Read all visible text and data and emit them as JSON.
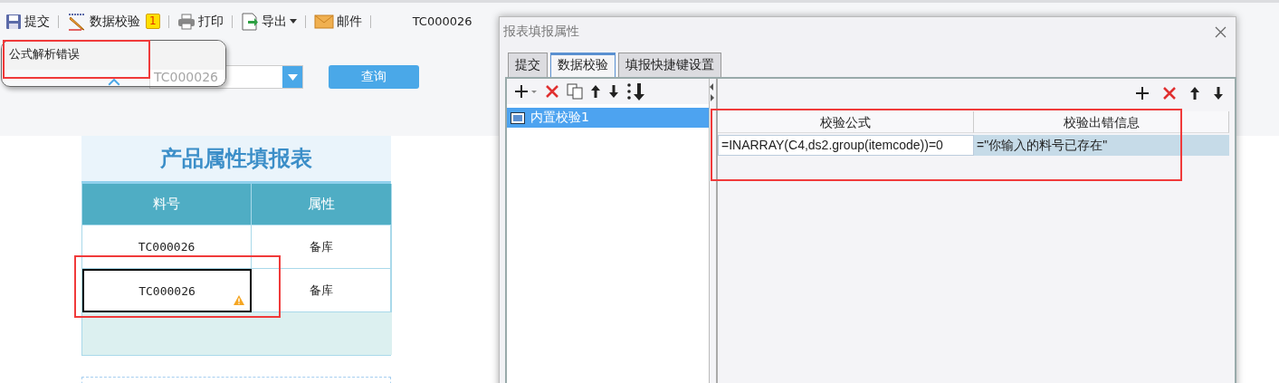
{
  "toolbar": {
    "items": [
      {
        "label": "提交"
      },
      {
        "label": "数据校验",
        "badge": "1"
      },
      {
        "label": "打印"
      },
      {
        "label": "导出",
        "dropdown": true
      },
      {
        "label": "邮件"
      }
    ],
    "value": "TC000026"
  },
  "query": {
    "combo_value": "TC000026",
    "button": "查询"
  },
  "tooltip": {
    "text": "公式解析错误"
  },
  "report": {
    "title": "产品属性填报表",
    "columns": [
      "料号",
      "属性"
    ],
    "rows": [
      {
        "cells": [
          "TC000026",
          "备库"
        ],
        "focused": false,
        "warning": false
      },
      {
        "cells": [
          "TC000026",
          "备库"
        ],
        "focused": true,
        "warning": true
      }
    ]
  },
  "dialog": {
    "title": "报表填报属性",
    "tabs": [
      {
        "label": "提交",
        "selected": false
      },
      {
        "label": "数据校验",
        "selected": true
      },
      {
        "label": "填报快捷键设置",
        "selected": false
      }
    ],
    "rules": [
      {
        "label": "内置校验1",
        "selected": true
      }
    ],
    "table": {
      "columns": [
        "校验公式",
        "校验出错信息"
      ],
      "rows": [
        {
          "cells": [
            "=INARRAY(C4,ds2.group(itemcode))=0",
            "=\"你输入的料号已存在\""
          ],
          "selected": true
        }
      ]
    }
  }
}
